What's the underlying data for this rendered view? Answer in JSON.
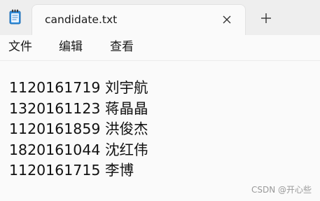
{
  "app": {
    "icon": "notepad-icon"
  },
  "tab": {
    "title": "candidate.txt",
    "close_icon": "close-icon"
  },
  "new_tab_icon": "plus-icon",
  "menu": {
    "file": "文件",
    "edit": "编辑",
    "view": "查看"
  },
  "editor": {
    "lines": [
      "1120161719 刘宇航",
      "1320161123 蒋晶晶",
      "1120161859 洪俊杰",
      "1820161044 沈红伟",
      "1120161715 李博"
    ]
  },
  "watermark": "CSDN @开心些"
}
